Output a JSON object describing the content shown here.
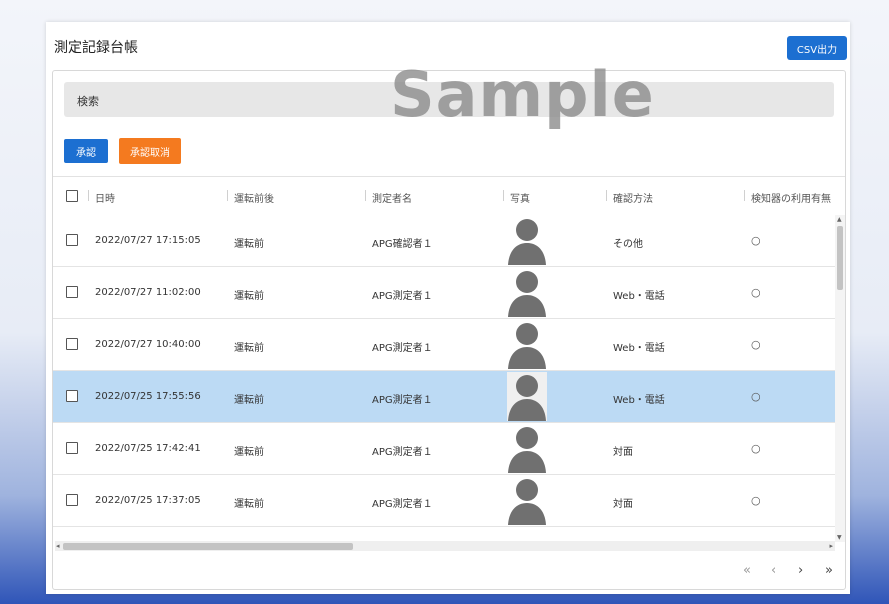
{
  "page": {
    "title": "測定記録台帳",
    "csv_button": "CSV出力",
    "watermark": "Sample"
  },
  "search": {
    "label": "検索"
  },
  "actions": {
    "approve": "承認",
    "cancel_approve": "承認取消"
  },
  "table": {
    "headers": [
      "日時",
      "運転前後",
      "測定者名",
      "写真",
      "確認方法",
      "検知器の利用有無"
    ],
    "rows": [
      {
        "datetime": "2022/07/27 17:15:05",
        "timing": "運転前",
        "person": "APG確認者１",
        "method": "その他",
        "detector": "○",
        "selected": false
      },
      {
        "datetime": "2022/07/27 11:02:00",
        "timing": "運転前",
        "person": "APG測定者１",
        "method": "Web・電話",
        "detector": "○",
        "selected": false
      },
      {
        "datetime": "2022/07/27 10:40:00",
        "timing": "運転前",
        "person": "APG測定者１",
        "method": "Web・電話",
        "detector": "○",
        "selected": false
      },
      {
        "datetime": "2022/07/25 17:55:56",
        "timing": "運転前",
        "person": "APG測定者１",
        "method": "Web・電話",
        "detector": "○",
        "selected": true
      },
      {
        "datetime": "2022/07/25 17:42:41",
        "timing": "運転前",
        "person": "APG測定者１",
        "method": "対面",
        "detector": "○",
        "selected": false
      },
      {
        "datetime": "2022/07/25 17:37:05",
        "timing": "運転前",
        "person": "APG測定者１",
        "method": "対面",
        "detector": "○",
        "selected": false
      }
    ]
  },
  "pagination": {
    "first": "«",
    "prev": "‹",
    "next": "›",
    "last": "»"
  },
  "colors": {
    "primary": "#1c6fd1",
    "warning": "#f47a1f",
    "selected_row": "#bcdaf4"
  },
  "icons": {
    "photo": "person-silhouette-icon",
    "checkbox": "checkbox-icon",
    "radio": "circle-icon"
  }
}
